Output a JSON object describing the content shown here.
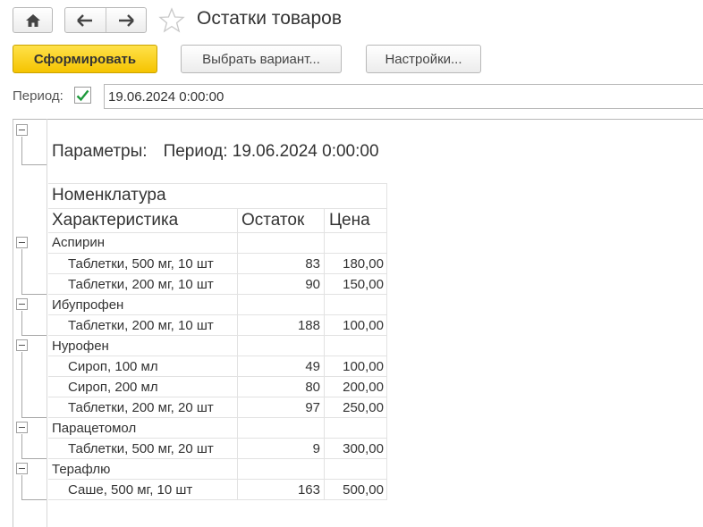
{
  "toolbar": {
    "home_icon": "home-icon",
    "back_icon": "arrow-left-icon",
    "forward_icon": "arrow-right-icon",
    "favorite_icon": "star-icon",
    "title": "Остатки товаров"
  },
  "actions": {
    "generate_label": "Сформировать",
    "variant_label": "Выбрать вариант...",
    "settings_label": "Настройки..."
  },
  "period": {
    "label": "Период:",
    "checked": true,
    "value": "19.06.2024  0:00:00"
  },
  "report": {
    "params_label": "Параметры:",
    "params_value": "Период: 19.06.2024 0:00:00",
    "headers": {
      "nomenclature": "Номенклатура",
      "characteristic": "Характеристика",
      "balance": "Остаток",
      "price": "Цена"
    },
    "groups": [
      {
        "name": "Аспирин",
        "items": [
          {
            "characteristic": "Таблетки, 500 мг, 10 шт",
            "balance": "83",
            "price": "180,00"
          },
          {
            "characteristic": "Таблетки, 200 мг, 10 шт",
            "balance": "90",
            "price": "150,00"
          }
        ]
      },
      {
        "name": "Ибупрофен",
        "items": [
          {
            "characteristic": "Таблетки, 200 мг, 10 шт",
            "balance": "188",
            "price": "100,00"
          }
        ]
      },
      {
        "name": "Нурофен",
        "items": [
          {
            "characteristic": "Сироп, 100 мл",
            "balance": "49",
            "price": "100,00"
          },
          {
            "characteristic": "Сироп, 200 мл",
            "balance": "80",
            "price": "200,00"
          },
          {
            "characteristic": "Таблетки, 200 мг, 20 шт",
            "balance": "97",
            "price": "250,00"
          }
        ]
      },
      {
        "name": "Парацетомол",
        "items": [
          {
            "characteristic": "Таблетки, 500 мг, 20 шт",
            "balance": "9",
            "price": "300,00"
          }
        ]
      },
      {
        "name": "Терафлю",
        "items": [
          {
            "characteristic": "Саше, 500 мг, 10 шт",
            "balance": "163",
            "price": "500,00"
          }
        ]
      }
    ]
  }
}
